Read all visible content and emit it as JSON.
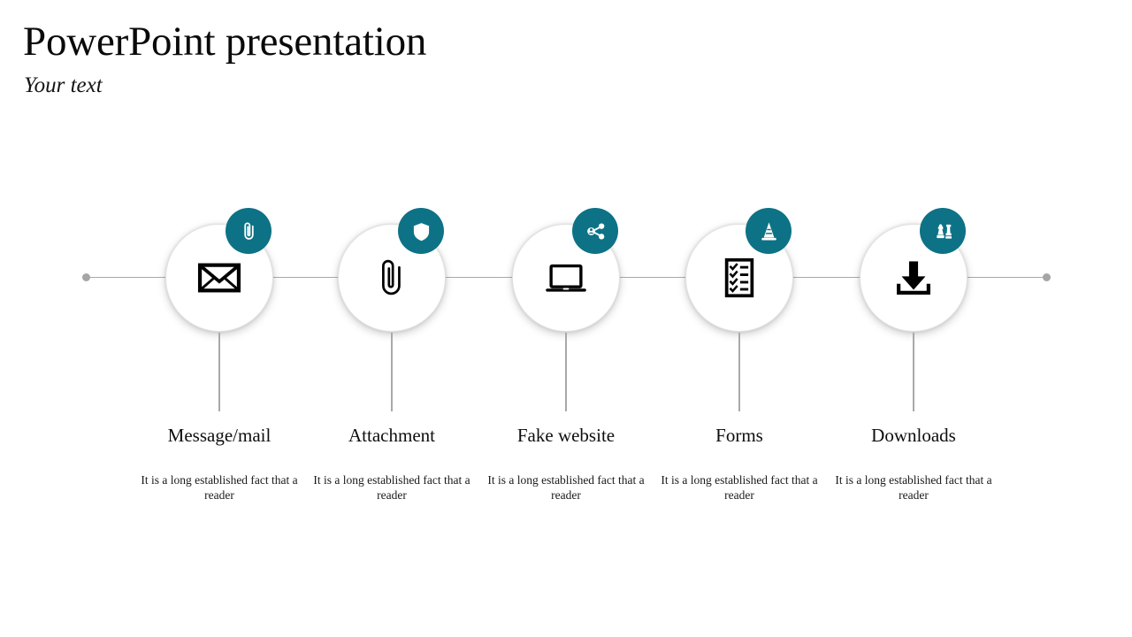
{
  "header": {
    "title": "PowerPoint presentation",
    "subtitle": "Your text"
  },
  "theme": {
    "accent": "#0d7286",
    "line": "#a9a9a9",
    "dot": "#a6a4a4",
    "icon": "#000000",
    "background": "#ffffff",
    "text": "#111111"
  },
  "timeline": {
    "axis_dot_left": "axis-dot",
    "axis_dot_right": "axis-dot",
    "steps": [
      {
        "label": "Message/mail",
        "description": "It is a long established fact that a reader",
        "main_icon": "envelope-icon",
        "badge_icon": "paperclip-icon"
      },
      {
        "label": "Attachment",
        "description": "It is a long established fact that a reader",
        "main_icon": "paperclip-icon",
        "badge_icon": "shield-icon"
      },
      {
        "label": "Fake website",
        "description": "It is a long established fact that a reader",
        "main_icon": "laptop-icon",
        "badge_icon": "share-network-icon"
      },
      {
        "label": "Forms",
        "description": "It is a long established fact that a reader",
        "main_icon": "checklist-icon",
        "badge_icon": "traffic-cone-icon"
      },
      {
        "label": "Downloads",
        "description": "It is a long established fact that a reader",
        "main_icon": "download-icon",
        "badge_icon": "chess-pieces-icon"
      }
    ]
  }
}
